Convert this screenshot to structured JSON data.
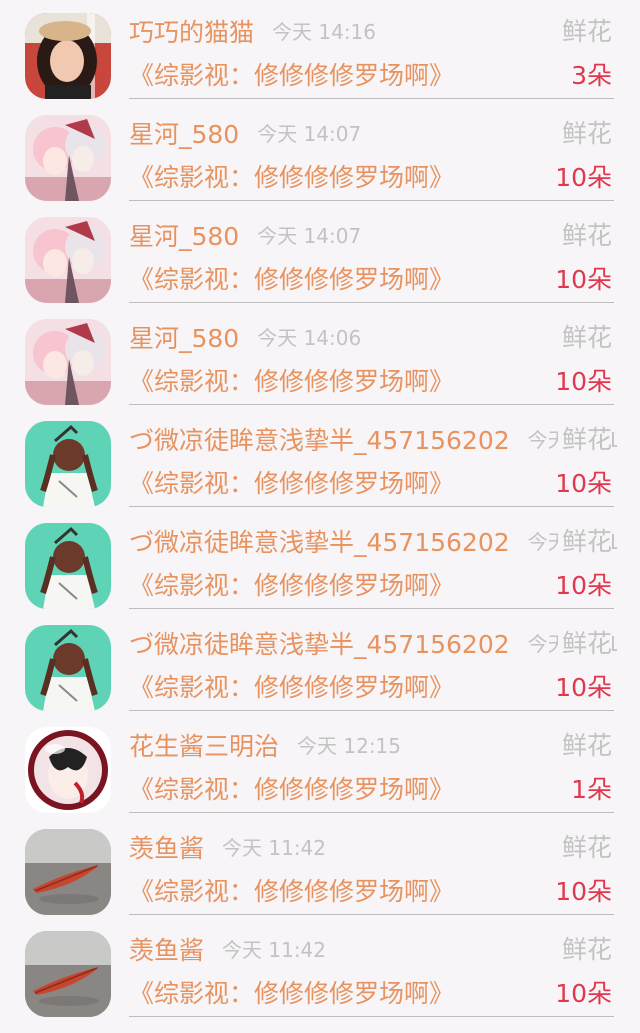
{
  "colors": {
    "name": "#e8935f",
    "time": "#c3c3c3",
    "count": "#e0394f",
    "background": "#f7f5f7"
  },
  "gifts": [
    {
      "avatar": "avatar-photo-woman",
      "name": "巧巧的猫猫",
      "time": "今天 14:16",
      "book": "《综影视：修修修修罗场啊》",
      "gift": "鲜花",
      "count": "3朵"
    },
    {
      "avatar": "avatar-anime-pink",
      "name": "星河_580",
      "time": "今天 14:07",
      "book": "《综影视：修修修修罗场啊》",
      "gift": "鲜花",
      "count": "10朵"
    },
    {
      "avatar": "avatar-anime-pink",
      "name": "星河_580",
      "time": "今天 14:07",
      "book": "《综影视：修修修修罗场啊》",
      "gift": "鲜花",
      "count": "10朵"
    },
    {
      "avatar": "avatar-anime-pink",
      "name": "星河_580",
      "time": "今天 14:06",
      "book": "《综影视：修修修修罗场啊》",
      "gift": "鲜花",
      "count": "10朵"
    },
    {
      "avatar": "avatar-girl-green",
      "name": "づ微凉徒眸意浅挚半_457156202",
      "time": "今天 12:1",
      "book": "《综影视：修修修修罗场啊》",
      "gift": "鲜花",
      "count": "10朵"
    },
    {
      "avatar": "avatar-girl-green",
      "name": "づ微凉徒眸意浅挚半_457156202",
      "time": "今天 12:1",
      "book": "《综影视：修修修修罗场啊》",
      "gift": "鲜花",
      "count": "10朵"
    },
    {
      "avatar": "avatar-girl-green",
      "name": "づ微凉徒眸意浅挚半_457156202",
      "time": "今天 12:1",
      "book": "《综影视：修修修修罗场啊》",
      "gift": "鲜花",
      "count": "10朵"
    },
    {
      "avatar": "avatar-orb-red",
      "name": "花生酱三明治",
      "time": "今天 12:15",
      "book": "《综影视：修修修修罗场啊》",
      "gift": "鲜花",
      "count": "1朵"
    },
    {
      "avatar": "avatar-leaf-street",
      "name": "羡鱼酱",
      "time": "今天 11:42",
      "book": "《综影视：修修修修罗场啊》",
      "gift": "鲜花",
      "count": "10朵"
    },
    {
      "avatar": "avatar-leaf-street",
      "name": "羡鱼酱",
      "time": "今天 11:42",
      "book": "《综影视：修修修修罗场啊》",
      "gift": "鲜花",
      "count": "10朵"
    }
  ]
}
